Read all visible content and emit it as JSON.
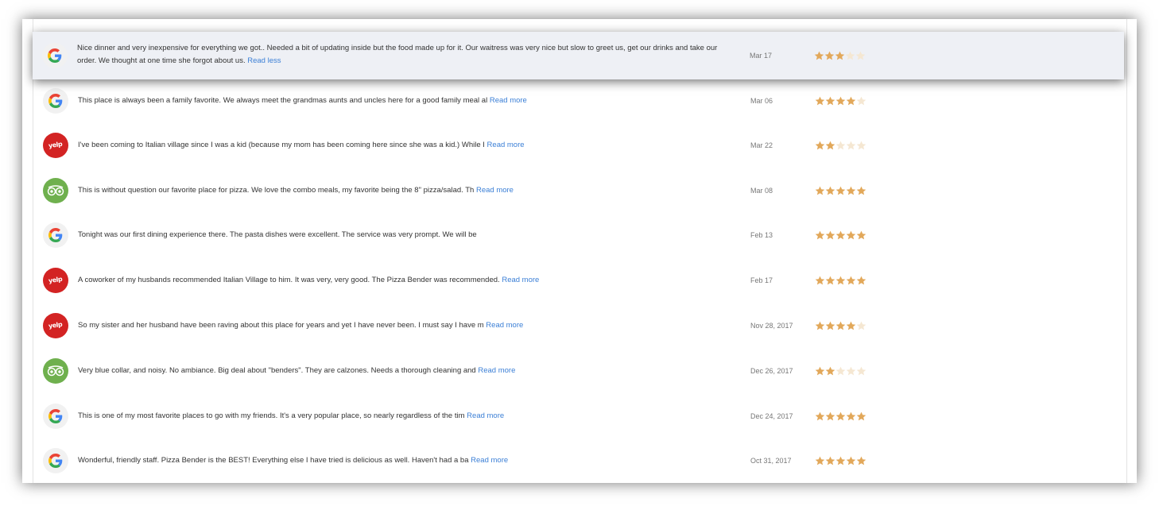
{
  "accent": {
    "link": "#3b7fd6",
    "star_on": "#e2a85a",
    "star_off": "#f5e7d2",
    "yelp": "#d32323",
    "tripadvisor": "#6fb04e"
  },
  "reviews": [
    {
      "source": "google",
      "icon": "google-icon",
      "text": "Nice dinner and very inexpensive for everything we got.. Needed a bit of updating inside but the food made up for it. Our waitress was very nice but slow to greet us, get our drinks and take our order. We thought at one time she forgot about us.",
      "link": "Read less",
      "date": "Mar 17",
      "rating": 3,
      "expanded": true
    },
    {
      "source": "google",
      "icon": "google-icon",
      "text": "This place is always been a family favorite. We always meet the grandmas aunts and uncles here for a good family meal al",
      "link": "Read more",
      "date": "Mar 06",
      "rating": 4
    },
    {
      "source": "yelp",
      "icon": "yelp-icon",
      "logo_text": "yelp",
      "text": "I've been coming to Italian village since I was a kid (because my mom has been coming here since she was a kid.) While I",
      "link": "Read more",
      "date": "Mar 22",
      "rating": 2
    },
    {
      "source": "tripadvisor",
      "icon": "tripadvisor-icon",
      "text": "This is without question our favorite place for pizza. We love the combo meals, my favorite being the 8\" pizza/salad. Th",
      "link": "Read more",
      "date": "Mar 08",
      "rating": 5
    },
    {
      "source": "google",
      "icon": "google-icon",
      "text": "Tonight was our first dining experience there. The pasta dishes were excellent. The service was very prompt. We will be",
      "link": "",
      "date": "Feb 13",
      "rating": 5
    },
    {
      "source": "yelp",
      "icon": "yelp-icon",
      "logo_text": "yelp",
      "text": "A coworker of my husbands recommended Italian Village to him. It was very, very good. The Pizza Bender was recommended.",
      "link": "Read more",
      "date": "Feb 17",
      "rating": 5
    },
    {
      "source": "yelp",
      "icon": "yelp-icon",
      "logo_text": "yelp",
      "text": "So my sister and her husband have been raving about this place for years and yet I have never been. I must say I have m",
      "link": "Read more",
      "date": "Nov 28, 2017",
      "rating": 4
    },
    {
      "source": "tripadvisor",
      "icon": "tripadvisor-icon",
      "text": "Very blue collar, and noisy. No ambiance. Big deal about \"benders\". They are calzones. Needs a thorough cleaning and",
      "link": "Read more",
      "date": "Dec 26, 2017",
      "rating": 2
    },
    {
      "source": "google",
      "icon": "google-icon",
      "text": "This is one of my most favorite places to go with my friends. It's a very popular place, so nearly regardless of the tim",
      "link": "Read more",
      "date": "Dec 24, 2017",
      "rating": 5
    },
    {
      "source": "google",
      "icon": "google-icon",
      "text": "Wonderful, friendly staff. Pizza Bender is the BEST! Everything else I have tried is delicious as well. Haven't had a ba",
      "link": "Read more",
      "date": "Oct 31, 2017",
      "rating": 5
    }
  ]
}
